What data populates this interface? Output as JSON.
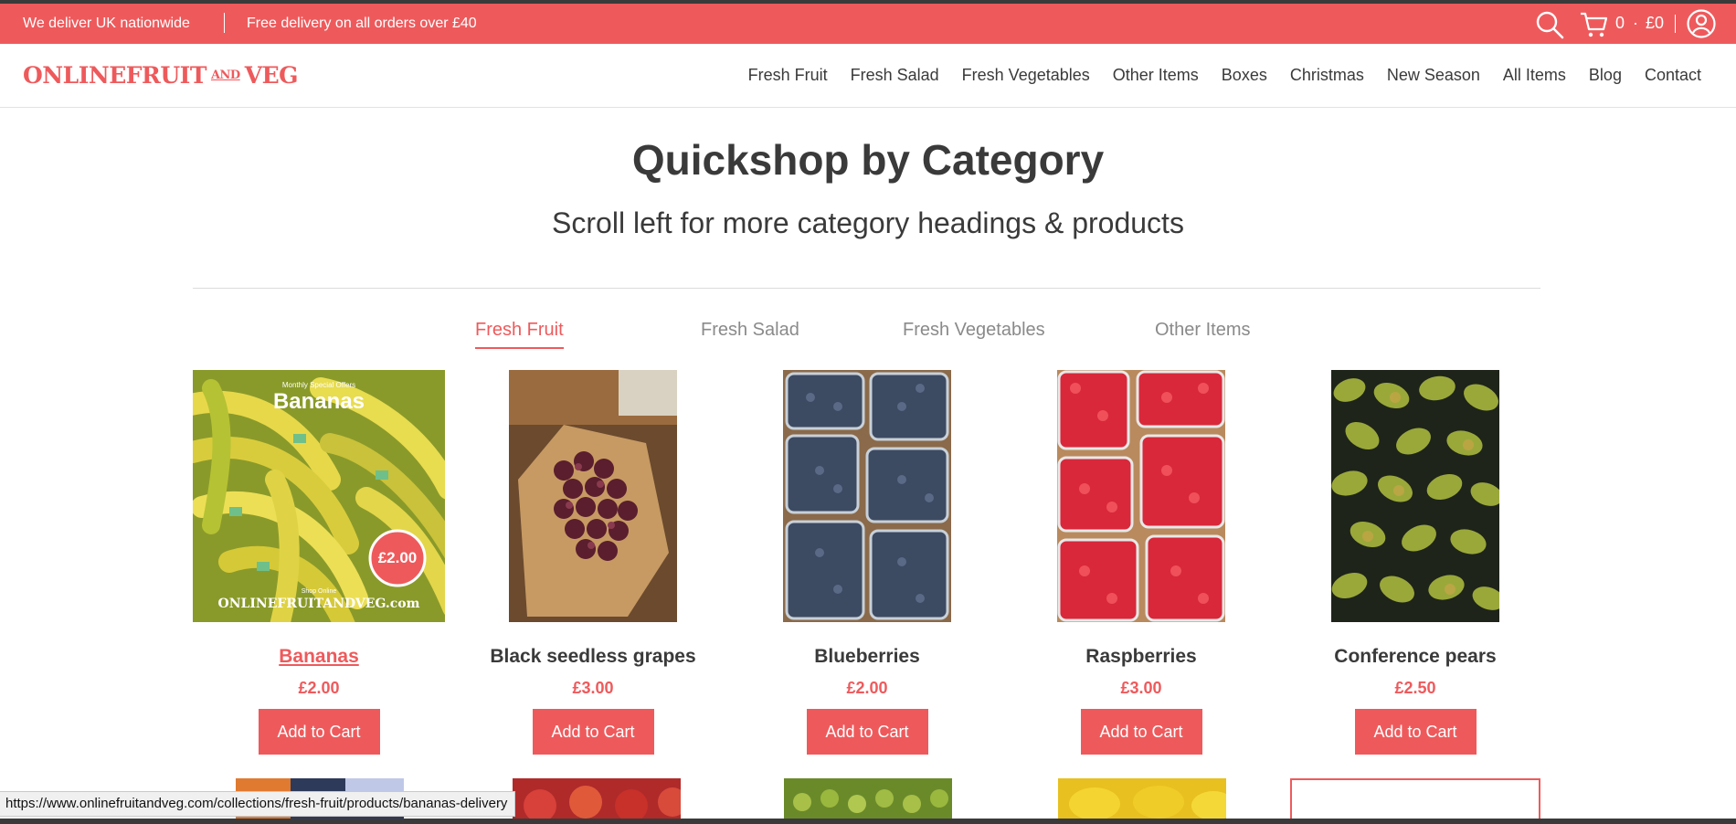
{
  "announcement": {
    "message_1": "We deliver UK nationwide",
    "message_2": "Free delivery on all orders over £40",
    "cart_count": "0",
    "cart_dot": "·",
    "cart_total": "£0",
    "icons": [
      "search-icon",
      "cart-icon",
      "account-icon"
    ]
  },
  "header": {
    "logo_left": "ONLINEFRUIT",
    "logo_mid": "AND",
    "logo_right": "VEG",
    "nav": [
      "Fresh Fruit",
      "Fresh Salad",
      "Fresh Vegetables",
      "Other Items",
      "Boxes",
      "Christmas",
      "New Season",
      "All Items",
      "Blog",
      "Contact"
    ]
  },
  "section": {
    "title": "Quickshop by Category",
    "subtitle": "Scroll left for more category headings & products"
  },
  "tabs": [
    {
      "label": "Fresh Fruit",
      "active": true
    },
    {
      "label": "Fresh Salad",
      "active": false
    },
    {
      "label": "Fresh Vegetables",
      "active": false
    },
    {
      "label": "Other Items",
      "active": false
    }
  ],
  "products": [
    {
      "name": "Bananas",
      "price": "£2.00",
      "button": "Add to Cart",
      "image_label_top": "Monthly Special Offers",
      "image_title": "Bananas",
      "image_badge": "£2.00",
      "image_footer_small": "Shop Online",
      "image_footer": "ONLINEFRUITANDVEG.com"
    },
    {
      "name": "Black seedless grapes",
      "price": "£3.00",
      "button": "Add to Cart"
    },
    {
      "name": "Blueberries",
      "price": "£2.00",
      "button": "Add to Cart"
    },
    {
      "name": "Raspberries",
      "price": "£3.00",
      "button": "Add to Cart"
    },
    {
      "name": "Conference pears",
      "price": "£2.50",
      "button": "Add to Cart"
    }
  ],
  "status_bar": {
    "url": "https://www.onlinefruitandveg.com/collections/fresh-fruit/products/bananas-delivery"
  },
  "colors": {
    "accent": "#ee5a5c",
    "text": "#3a3a3a",
    "muted": "#8a8a8a"
  }
}
